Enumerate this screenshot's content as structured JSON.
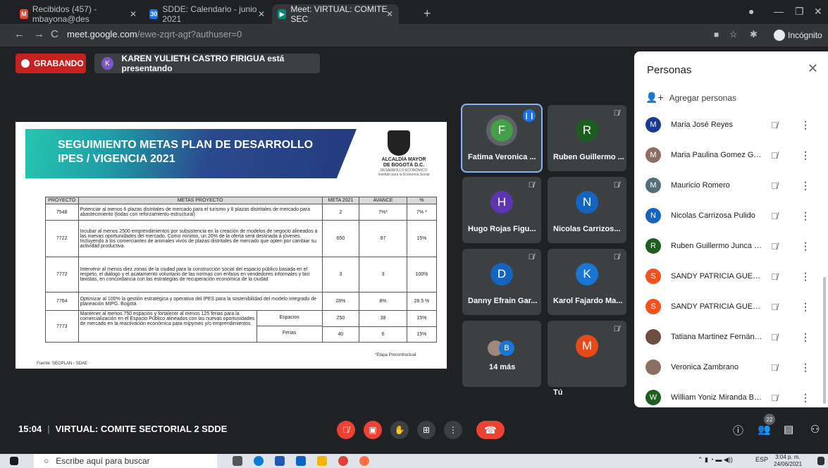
{
  "browser": {
    "tabs": [
      {
        "label": "Recibidos (457) - mbayona@des",
        "icon": "gmail-icon"
      },
      {
        "label": "SDDE: Calendario - junio 2021",
        "icon": "calendar-icon"
      },
      {
        "label": "Meet: VIRTUAL: COMITE SEC",
        "icon": "meet-icon"
      }
    ],
    "url_host": "meet.google.com",
    "url_path": "/ewe-zqrt-agt?authuser=0",
    "incognito_label": "Incógnito"
  },
  "meet": {
    "recording_label": "GRABANDO",
    "presenter_initial": "K",
    "presenting_text": "KAREN YULIETH CASTRO FIRIGUA está presentando",
    "meeting_time": "15:04",
    "meeting_name": "VIRTUAL: COMITE SECTORIAL 2 SDDE",
    "participants_count": "22",
    "tiles": [
      {
        "initial": "F",
        "name": "Fatima Veronica ...",
        "color": "#43a047"
      },
      {
        "initial": "R",
        "name": "Ruben Guillermo ...",
        "color": "#1b5e20"
      },
      {
        "initial": "H",
        "name": "Hugo Rojas Figu...",
        "color": "#5e35b1"
      },
      {
        "initial": "N",
        "name": "Nicolas Carrizos...",
        "color": "#1565c0"
      },
      {
        "initial": "D",
        "name": "Danny Efrain Gar...",
        "color": "#1565c0"
      },
      {
        "initial": "K",
        "name": "Karol Fajardo Ma...",
        "color": "#1976d2"
      },
      {
        "initial": "B",
        "name": "14 más",
        "color": "#1976d2"
      },
      {
        "initial": "M",
        "name": "Tú",
        "color": "#e64a19"
      }
    ]
  },
  "slide": {
    "title_line1": "SEGUIMIENTO METAS PLAN DE DESARROLLO",
    "title_line2": "IPES / VIGENCIA 2021",
    "logo_line1": "ALCALDÍA MAYOR",
    "logo_line2": "DE BOGOTÁ D.C.",
    "logo_line3": "DESARROLLO ECONÓMICO",
    "logo_line4": "Instituto para la Economía Social",
    "headers": [
      "PROYECTO",
      "METAS PROYECTO",
      "META 2021",
      "AVANCE",
      "%"
    ],
    "rows": [
      {
        "proyecto": "7548",
        "meta": "Potenciar al menos 6 plazas distritales de mercado para el turismo y 8 plazas distritales de mercado para abastecimiento (todas con reforzamiento estructural)",
        "meta2021": "2",
        "avance": "7%*",
        "pct": "7% *"
      },
      {
        "proyecto": "7722",
        "meta": "Incubar al menos 2500 emprendimientos por subsistencia en la creación de modelos de negocio alineados a las nuevas oportunidades del mercado. Como mínimo, un 20% de la oferta será destinada a jóvenes. Incluyendo a los comerciantes de animales vivos de plazas distritales de mercado que opten por cambiar su actividad productiva.",
        "meta2021": "650",
        "avance": "97",
        "pct": "15%"
      },
      {
        "proyecto": "7772",
        "meta": "Intervenir al menos diez zonas de la ciudad para la construcción social del espacio público basada en el respeto, el diálogo y el acatamiento voluntario de las normas con énfasis en vendedores informales y bici taxistas, en concordancia con las estrategias de recuperación económica de la ciudad",
        "meta2021": "3",
        "avance": "3",
        "pct": "100%"
      },
      {
        "proyecto": "7764",
        "meta": "Optimizar al 100% la gestión estratégica y operativa del IPES para la sostenibilidad del modelo integrado de planeación MIPG. Bogotá",
        "meta2021": "28%",
        "avance": "8%",
        "pct": "28.5 %"
      }
    ],
    "last_row": {
      "proyecto": "7773",
      "meta": "Mantener al menos 750 espacios y fortalecer al menos 125 ferias para la comercialización en el Espacio Público alineados con las nuevas oportunidades de mercado en la reactivación económica para mipymes y/o emprendimientos",
      "sub": [
        {
          "label": "Espacios",
          "meta2021": "250",
          "avance": "38",
          "pct": "15%"
        },
        {
          "label": "Ferias",
          "meta2021": "40",
          "avance": "6",
          "pct": "15%"
        }
      ]
    },
    "footnote": "*Etapa Precontractual",
    "source": "Fuente: SEGPLAN - SDAE"
  },
  "people_panel": {
    "title": "Personas",
    "add_label": "Agregar personas",
    "people": [
      {
        "initial": "M",
        "name": "Maria José Reyes",
        "color": "#1a3a8f"
      },
      {
        "initial": "M",
        "name": "Maria Paulina Gomez Go...",
        "color": "#8d6e63"
      },
      {
        "initial": "M",
        "name": "Mauricio Romero",
        "color": "#546e7a"
      },
      {
        "initial": "N",
        "name": "Nicolas Carrizosa Pulido",
        "color": "#1565c0"
      },
      {
        "initial": "R",
        "name": "Ruben Guillermo Junca M...",
        "color": "#1b5e20"
      },
      {
        "initial": "S",
        "name": "SANDY PATRICIA GUERRE...",
        "color": "#f4511e"
      },
      {
        "initial": "S",
        "name": "SANDY PATRICIA GUERRE...",
        "color": "#f4511e"
      },
      {
        "initial": "",
        "name": "Tatiana Martinez Fernánd...",
        "color": "#6d4c41"
      },
      {
        "initial": "",
        "name": "Veronica Zambrano",
        "color": "#8d6e63"
      },
      {
        "initial": "W",
        "name": "William Yoniz Miranda Bran",
        "color": "#1b5e20"
      }
    ]
  },
  "taskbar": {
    "search_placeholder": "Escribe aquí para buscar",
    "lang": "ESP",
    "time": "3:04 p. m.",
    "date": "24/06/2021"
  }
}
